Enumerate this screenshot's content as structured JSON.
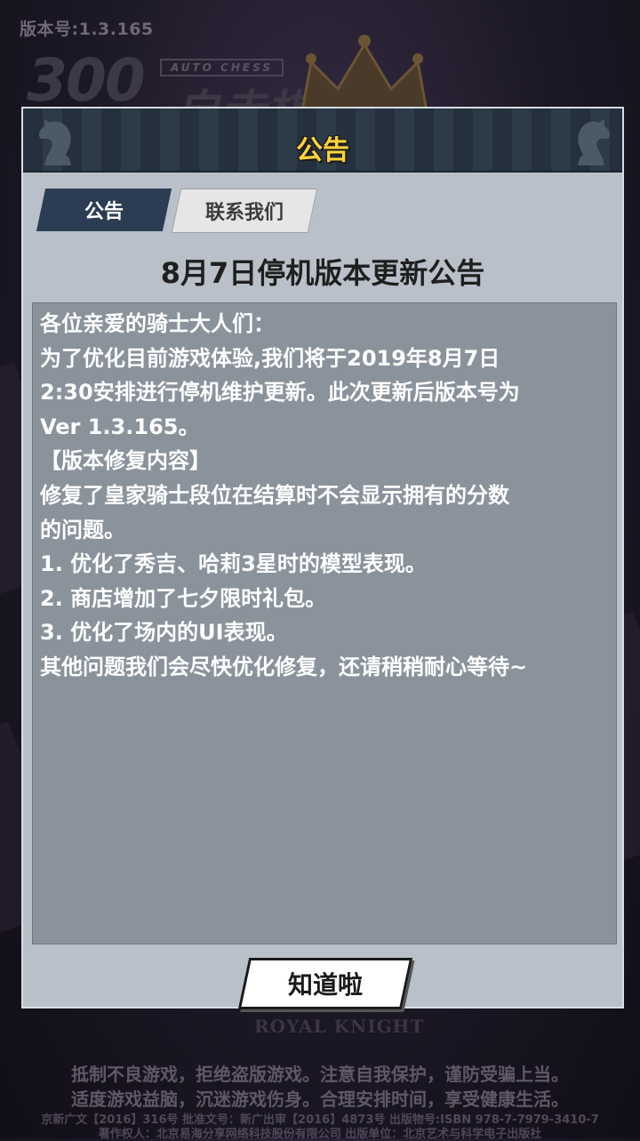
{
  "version_label": "版本号:1.3.165",
  "logo": {
    "number": "300",
    "subtitle": "AUTO CHESS",
    "title": "自走棋"
  },
  "dialog": {
    "title": "公告",
    "tabs": [
      {
        "label": "公告",
        "active": true
      },
      {
        "label": "联系我们",
        "active": false
      }
    ],
    "notice_title": "8月7日停机版本更新公告",
    "body_lines": [
      "各位亲爱的骑士大人们：",
      " 为了优化目前游戏体验,我们将于2019年8月7日",
      "2:30安排进行停机维护更新。此次更新后版本号为",
      "Ver 1.3.165。",
      "【版本修复内容】",
      "修复了皇家骑士段位在结算时不会显示拥有的分数",
      "的问题。",
      "1. 优化了秀吉、哈莉3星时的模型表现。",
      "2. 商店增加了七夕限时礼包。",
      "3. 优化了场内的UI表现。",
      " 其他问题我们会尽快优化修复，还请稍稍耐心等待~"
    ],
    "confirm_label": "知道啦"
  },
  "background_text": "ROYAL KNIGHT",
  "footer": {
    "line1": "抵制不良游戏，拒绝盗版游戏。注意自我保护，谨防受骗上当。",
    "line2": "适度游戏益脑，沉迷游戏伤身。合理安排时间，享受健康生活。",
    "line3": "京新广文【2016】316号  批准文号：新广出审【2016】4873号  出版物号:ISBN 978-7-7979-3410-7",
    "line4": "著作权人：北京易海分享网络科技股份有限公司    出版单位：北京艺术与科学电子出版社"
  },
  "colors": {
    "title_yellow": "#ffd33a",
    "tab_active": "#2b3d52",
    "panel": "#b9c0c9",
    "content_bg": "#8a939c"
  }
}
